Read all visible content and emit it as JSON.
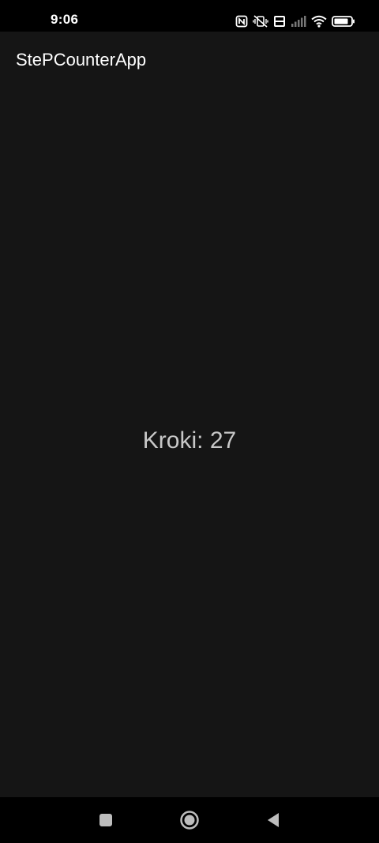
{
  "status_bar": {
    "time": "9:06",
    "icons": [
      "nfc-icon",
      "mute-vibrate-icon",
      "volte-icon",
      "signal-icon",
      "wifi-icon",
      "battery-icon"
    ]
  },
  "app_bar": {
    "title": "StePCounterApp"
  },
  "main": {
    "steps_text": "Kroki: 27"
  },
  "nav_bar": {
    "buttons": [
      "recents-button",
      "home-button",
      "back-button"
    ]
  },
  "colors": {
    "background": "#151515",
    "bars": "#000000",
    "title_text": "#ffffff",
    "body_text": "#c8c8c8"
  }
}
